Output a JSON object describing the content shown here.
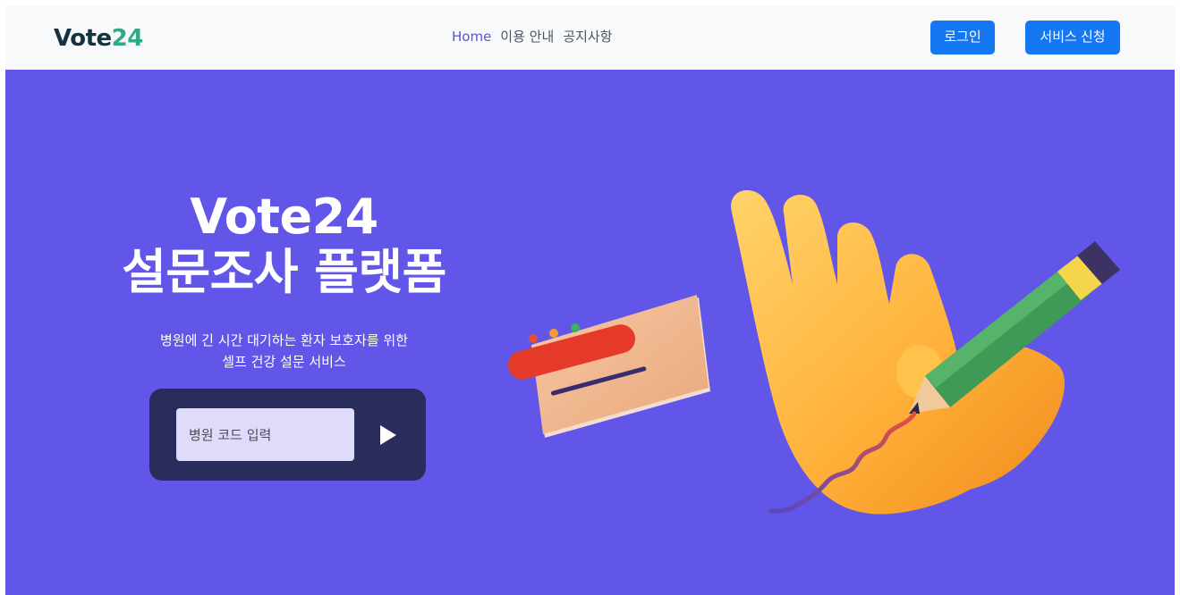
{
  "header": {
    "logo_text": "Vote",
    "logo_number": "24",
    "nav": [
      {
        "label": "Home",
        "active": true
      },
      {
        "label": "이용 안내",
        "active": false
      },
      {
        "label": "공지사항",
        "active": false
      }
    ],
    "login_label": "로그인",
    "apply_label": "서비스 신청"
  },
  "hero": {
    "title_line1": "Vote24",
    "title_line2": "설문조사 플랫폼",
    "subtitle_line1": "병원에 긴 시간 대기하는 환자 보호자를 위한",
    "subtitle_line2": "셀프 건강 설문 서비스",
    "code_placeholder": "병원 코드 입력",
    "submit_icon": "play-triangle-icon",
    "illustration": "hand-holding-pencil-illustration"
  },
  "colors": {
    "hero_bg": "#6156e8",
    "nav_bg": "#f8f9fa",
    "button": "#1677f2",
    "code_box": "#2a2c5c",
    "logo_accent": "#2fa987"
  }
}
